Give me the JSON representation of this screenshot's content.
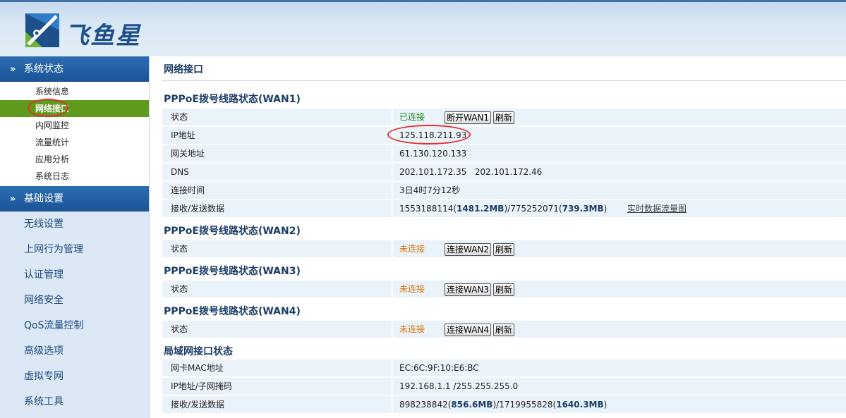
{
  "brand": {
    "name": "飞鱼星"
  },
  "sidebar": {
    "section1": {
      "label": "系统状态",
      "items": [
        "系统信息",
        "网络接口",
        "内网监控",
        "流量统计",
        "应用分析",
        "系统日志"
      ],
      "active": "网络接口"
    },
    "section2": {
      "label": "基础设置"
    },
    "items": [
      "无线设置",
      "上网行为管理",
      "认证管理",
      "网络安全",
      "QoS流量控制",
      "高级选项",
      "虚拟专网",
      "系统工具"
    ]
  },
  "main": {
    "title": "网络接口",
    "wan1": {
      "title": "PPPoE拨号线路状态(WAN1)",
      "status_label": "状态",
      "status": "已连接",
      "disconnect_btn": "断开WAN1",
      "refresh_btn": "刷新",
      "ip_label": "IP地址",
      "ip": "125.118.211.93",
      "gateway_label": "网关地址",
      "gateway": "61.130.120.133",
      "dns_label": "DNS",
      "dns1": "202.101.172.35",
      "dns2": "202.101.172.46",
      "uptime_label": "连接时间",
      "uptime": "3日4时7分12秒",
      "traffic_label": "接收/发送数据",
      "rx_bytes": "1553188114",
      "rx_mb": "1481.2MB",
      "tx_bytes": "775252071",
      "tx_mb": "739.3MB",
      "chart_link": "实时数据流量图"
    },
    "wan2": {
      "title": "PPPoE拨号线路状态(WAN2)",
      "status_label": "状态",
      "status": "未连接",
      "connect_btn": "连接WAN2",
      "refresh_btn": "刷新"
    },
    "wan3": {
      "title": "PPPoE拨号线路状态(WAN3)",
      "status_label": "状态",
      "status": "未连接",
      "connect_btn": "连接WAN3",
      "refresh_btn": "刷新"
    },
    "wan4": {
      "title": "PPPoE拨号线路状态(WAN4)",
      "status_label": "状态",
      "status": "未连接",
      "connect_btn": "连接WAN4",
      "refresh_btn": "刷新"
    },
    "lan": {
      "title": "局域网接口状态",
      "mac_label": "网卡MAC地址",
      "mac": "EC:6C:9F:10:E6:BC",
      "ip_label": "IP地址/子网掩码",
      "ip_mask": "192.168.1.1 /255.255.255.0",
      "traffic_label": "接收/发送数据",
      "rx_bytes": "898238842",
      "rx_mb": "856.6MB",
      "tx_bytes": "1719955828",
      "tx_mb": "1640.3MB"
    }
  },
  "colors": {
    "accent": "#1b5597",
    "active": "#5f9a1c",
    "ok": "#1a8a1a",
    "warn": "#e07000",
    "highlight": "#e03030"
  }
}
